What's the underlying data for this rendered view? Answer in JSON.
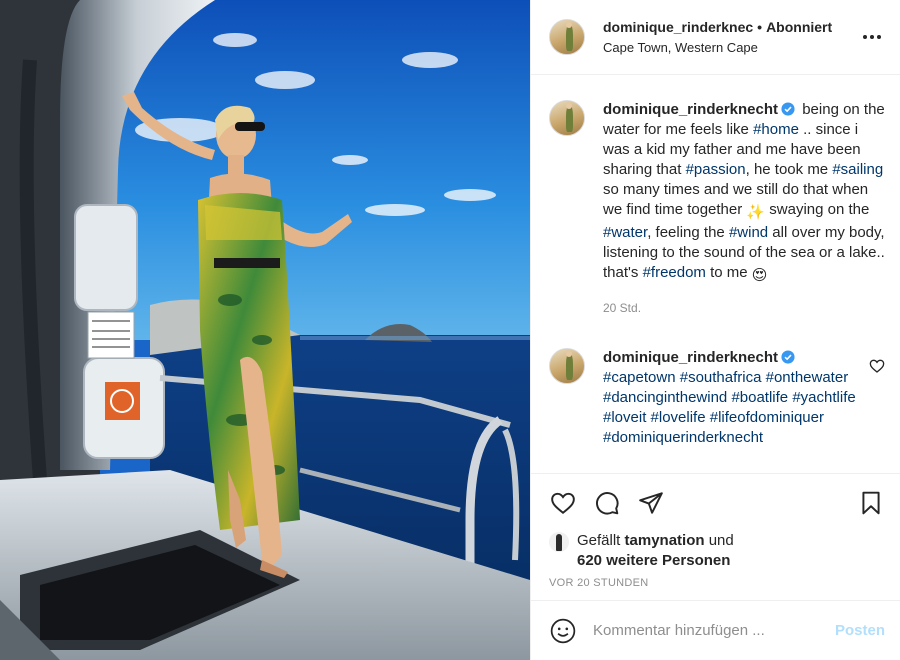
{
  "header": {
    "username": "dominique_rinderknec",
    "separator": "•",
    "follow_status": "Abonniert",
    "location": "Cape Town, Western Cape",
    "more_icon": "more-horizontal-icon"
  },
  "caption": {
    "username": "dominique_rinderknecht",
    "verified_icon": "verified-badge-icon",
    "segments": [
      {
        "text": "being on the water for me feels like ",
        "tag": false
      },
      {
        "text": "#home",
        "tag": true
      },
      {
        "text": " .. since i was a kid my father and me have been sharing that ",
        "tag": false
      },
      {
        "text": "#passion",
        "tag": true
      },
      {
        "text": ", he took me ",
        "tag": false
      },
      {
        "text": "#sailing",
        "tag": true
      },
      {
        "text": " so many times and we still do that when we find time together ",
        "tag": false
      },
      {
        "text": "✨",
        "tag": false,
        "emoji": true
      },
      {
        "text": " swaying on the ",
        "tag": false
      },
      {
        "text": "#water",
        "tag": true
      },
      {
        "text": ", feeling the ",
        "tag": false
      },
      {
        "text": "#wind",
        "tag": true
      },
      {
        "text": " all over my body, listening to the sound of the sea or a lake.. that's ",
        "tag": false
      },
      {
        "text": "#freedom",
        "tag": true
      },
      {
        "text": " to me ",
        "tag": false
      },
      {
        "text": "😍",
        "tag": false,
        "emoji": true
      }
    ],
    "time": "20 Std."
  },
  "comment": {
    "username": "dominique_rinderknecht",
    "hashtags": [
      "#capetown",
      "#southafrica",
      "#onthewater",
      "#dancinginthewind",
      "#boatlife",
      "#yachtlife",
      "#loveit",
      "#lovelife",
      "#lifeofdominiquer",
      "#dominiquerinderknecht"
    ],
    "like_icon": "heart-outline-icon"
  },
  "actions": {
    "like_icon": "heart-icon",
    "comment_icon": "comment-icon",
    "share_icon": "share-icon",
    "save_icon": "bookmark-icon"
  },
  "likes": {
    "prefix": "Gefällt",
    "liker": "tamynation",
    "middle": "und",
    "others": "620 weitere Personen"
  },
  "timestamp": "Vor 20 Stunden",
  "comment_box": {
    "emoji_icon": "smiley-icon",
    "placeholder": "Kommentar hinzufügen ...",
    "post_label": "Posten"
  },
  "colors": {
    "hashtag": "#00376b",
    "verified": "#3897f0",
    "post_button_disabled": "#b2dffc",
    "muted": "#8e8e8e"
  }
}
